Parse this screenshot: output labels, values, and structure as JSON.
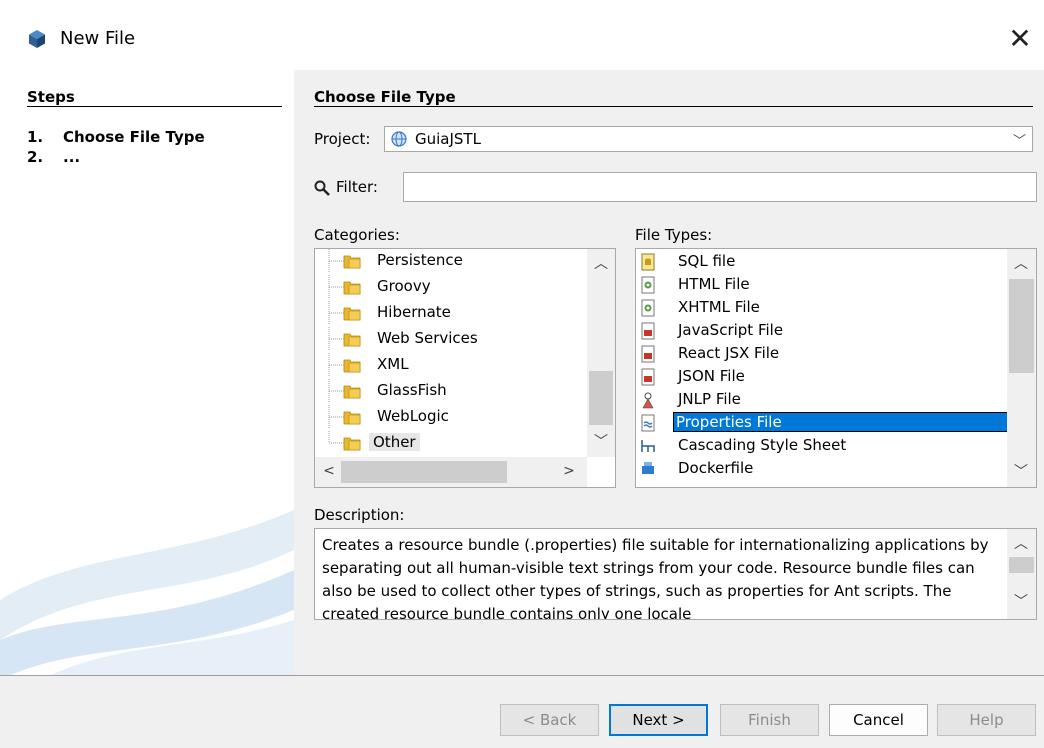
{
  "window": {
    "title": "New File",
    "close_glyph": "✕",
    "icon": "netbeans-cube-icon"
  },
  "steps": {
    "heading": "Steps",
    "items": [
      {
        "num": "1.",
        "label": "Choose File Type"
      },
      {
        "num": "2.",
        "label": "..."
      }
    ]
  },
  "main": {
    "heading": "Choose File Type",
    "project": {
      "label": "Project:",
      "value": "GuiaJSTL"
    },
    "filter": {
      "label": "Filter:",
      "value": ""
    },
    "categories": {
      "label": "Categories:",
      "items": [
        "Persistence",
        "Groovy",
        "Hibernate",
        "Web Services",
        "XML",
        "GlassFish",
        "WebLogic",
        "Other"
      ],
      "selected": "Other"
    },
    "file_types": {
      "label": "File Types:",
      "items": [
        "SQL file",
        "HTML File",
        "XHTML File",
        "JavaScript File",
        "React JSX File",
        "JSON File",
        "JNLP File",
        "Properties File",
        "Cascading Style Sheet",
        "Dockerfile"
      ],
      "selected": "Properties File"
    },
    "description": {
      "label": "Description:",
      "text": "Creates a resource bundle (.properties) file suitable for internationalizing applications by separating out all human-visible text strings from your code. Resource bundle files can also be used to collect other types of strings, such as properties for Ant scripts. The created resource bundle contains only one locale"
    }
  },
  "buttons": {
    "back": "< Back",
    "next": "Next >",
    "finish": "Finish",
    "cancel": "Cancel",
    "help": "Help"
  },
  "colors": {
    "selection": "#0078d7",
    "panel": "#f0f0f0",
    "folder": "#e8b830"
  }
}
